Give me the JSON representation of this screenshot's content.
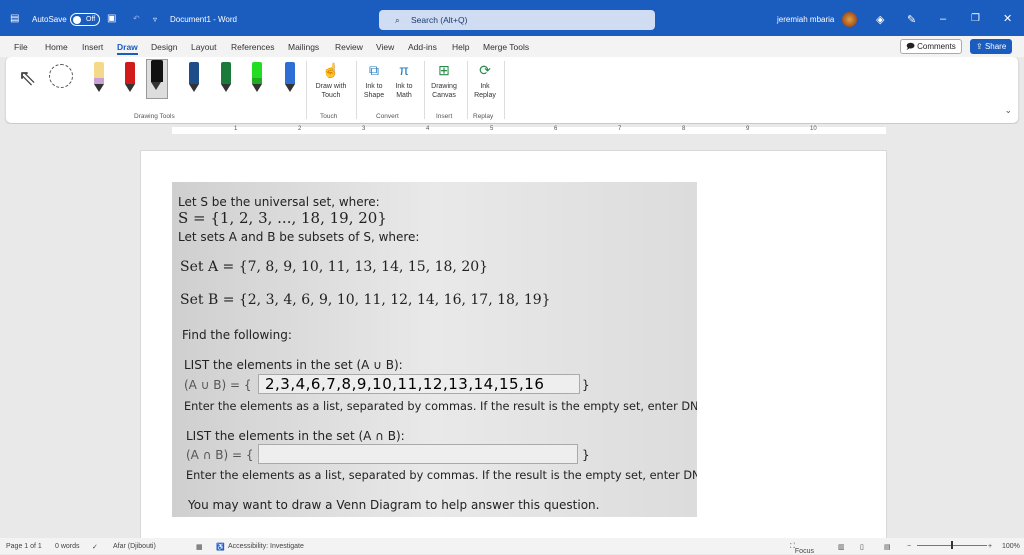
{
  "titlebar": {
    "autosave": "AutoSave",
    "toggle": "Off",
    "doc_title": "Document1 - Word",
    "search_placeholder": "Search (Alt+Q)",
    "user": "jeremiah mbaria"
  },
  "menu": [
    "File",
    "Home",
    "Insert",
    "Draw",
    "Design",
    "Layout",
    "References",
    "Mailings",
    "Review",
    "View",
    "Add-ins",
    "Help",
    "Merge Tools"
  ],
  "active_menu": "Draw",
  "actions": {
    "comments": "Comments",
    "share": "Share"
  },
  "ribbon": {
    "groups": {
      "drawing_tools": "Drawing Tools",
      "touch": "Touch",
      "convert": "Convert",
      "insert": "Insert",
      "replay": "Replay"
    },
    "buttons": {
      "draw_touch": [
        "Draw with",
        "Touch"
      ],
      "ink_shape": [
        "Ink to",
        "Shape"
      ],
      "ink_math": [
        "Ink to",
        "Math"
      ],
      "drawing_canvas": [
        "Drawing",
        "Canvas"
      ],
      "ink_replay": [
        "Ink",
        "Replay"
      ]
    },
    "pens": [
      {
        "color": "#f5d98b",
        "tip": "#c9a0d8"
      },
      {
        "color": "#d11a1a",
        "tip": "#d11a1a"
      },
      {
        "color": "#111111",
        "tip": "#111111"
      },
      {
        "color": "#1d4e89",
        "tip": "#1d4e89"
      },
      {
        "color": "#1a7a3a",
        "tip": "#1a7a3a"
      },
      {
        "color": "#22dd22",
        "tip": "#22aa22"
      },
      {
        "color": "#2e6fd6",
        "tip": "#2e6fd6"
      }
    ]
  },
  "ruler": [
    "1",
    "2",
    "3",
    "4",
    "5",
    "6",
    "7",
    "8",
    "9",
    "10"
  ],
  "problem": {
    "l1": "Let S be the universal set, where:",
    "l2": "S = {1, 2, 3, ..., 18, 19, 20}",
    "l3": "Let sets A and B be subsets of S, where:",
    "l4": "Set A = {7, 8, 9, 10, 11, 13, 14, 15, 18, 20}",
    "l5": "Set B = {2, 3, 4, 6, 9, 10, 11, 12, 14, 16, 17, 18, 19}",
    "l6": "Find the following:",
    "q1": "LIST the elements in the set (A ∪ B):",
    "q1_prefix": "(A ∪ B) = {",
    "q1_answer": "2,3,4,6,7,8,9,10,11,12,13,14,15,16",
    "close": "}",
    "hint": "Enter the elements as a list, separated by commas. If the result is the empty set, enter DNE",
    "q2": "LIST the elements in the set (A ∩ B):",
    "q2_prefix": "(A ∩ B) = {",
    "q2_answer": "",
    "venn": "You may want to draw a Venn Diagram to help answer this question."
  },
  "status": {
    "page": "Page 1 of 1",
    "words": "0 words",
    "language": "Afar (Djibouti)",
    "accessibility": "Accessibility: Investigate",
    "focus": "Focus",
    "zoom": "100%",
    "zoom_value": 100
  }
}
